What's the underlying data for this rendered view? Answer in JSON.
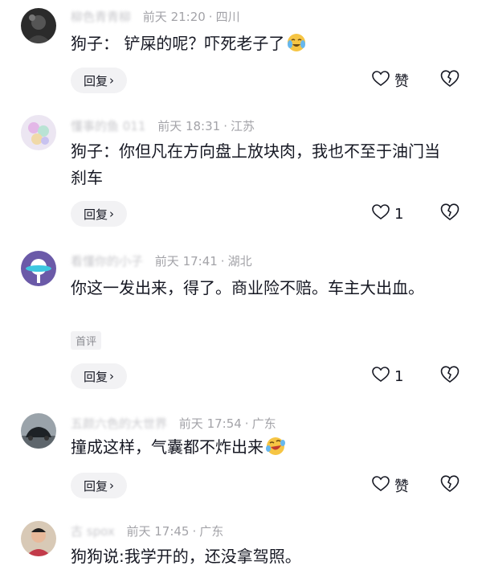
{
  "comments": [
    {
      "author": "柳色青青柳",
      "time": "前天 21:20",
      "location": "四川",
      "text": "狗子：  铲屎的呢？吓死老子了",
      "emoji": "crying-laughing-emoji",
      "reply_label": "回复",
      "like_label": "赞"
    },
    {
      "author": "懂事的鱼 011",
      "time": "前天 18:31",
      "location": "江苏",
      "text": "狗子：你但凡在方向盘上放块肉，我也不至于油门当刹车",
      "reply_label": "回复",
      "like_label": "1"
    },
    {
      "author": "看懂你的小子",
      "time": "前天 17:41",
      "location": "湖北",
      "text": "你这一发出来，得了。商业险不赔。车主大出血。",
      "tag": "首评",
      "reply_label": "回复",
      "like_label": "1"
    },
    {
      "author": "五颜六色的大世界",
      "time": "前天 17:54",
      "location": "广东",
      "text": "撞成这样，气囊都不炸出来",
      "emoji": "rofl-emoji",
      "reply_label": "回复",
      "like_label": "赞"
    },
    {
      "author": "古 spox",
      "time": "前天 17:45",
      "location": "广东",
      "text": "狗狗说:我学开的，还没拿驾照。"
    }
  ],
  "colors": {
    "meta": "#a3a3a8",
    "text": "#161823",
    "reply_bg": "#f2f2f4"
  }
}
